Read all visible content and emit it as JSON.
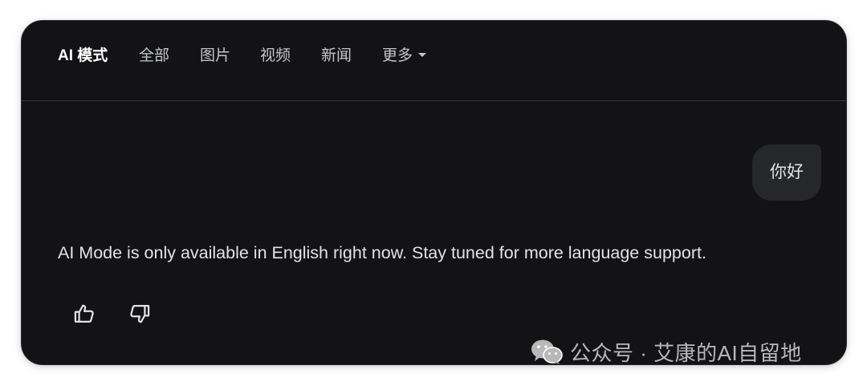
{
  "tabs": {
    "ai_mode": "AI 模式",
    "all": "全部",
    "images": "图片",
    "videos": "视频",
    "news": "新闻",
    "more": "更多"
  },
  "chat": {
    "user_message": "你好",
    "ai_message": "AI Mode is only available in English right now. Stay tuned for more language support."
  },
  "feedback": {
    "thumbs_up_icon": "thumbs-up-icon",
    "thumbs_down_icon": "thumbs-down-icon"
  },
  "watermark": {
    "text": "公众号 · 艾康的AI自留地",
    "icon": "wechat-icon"
  },
  "colors": {
    "panel_bg": "#131316",
    "bubble_bg": "#26272b",
    "text_primary": "#e3e3e3",
    "text_secondary": "#c4c7c5"
  }
}
